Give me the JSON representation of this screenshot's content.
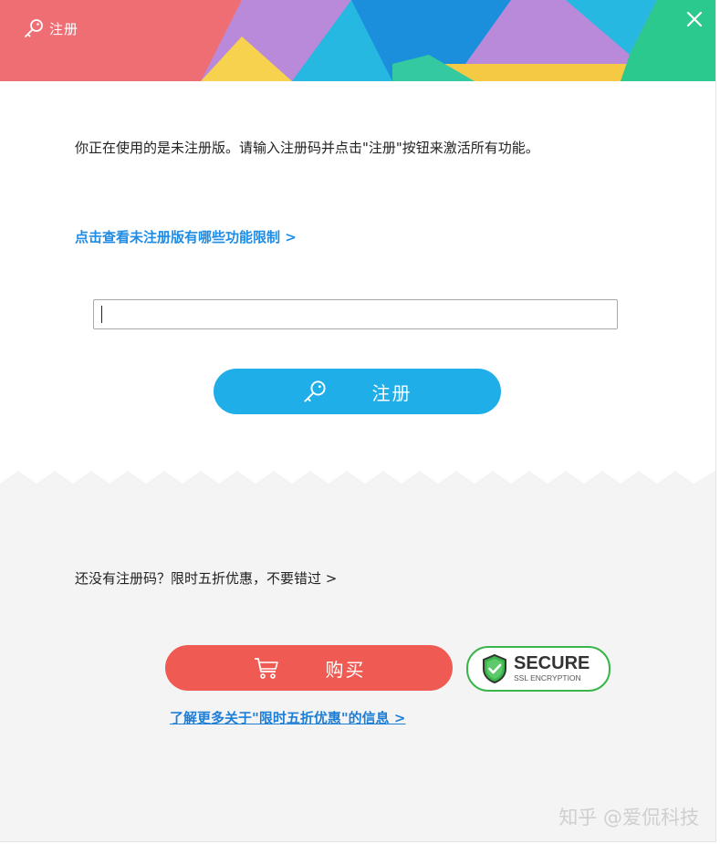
{
  "window": {
    "title": "注册",
    "colors": {
      "accent": "#1faee8",
      "buy": "#ef5b52",
      "link": "#1f8ce6",
      "secure_green": "#39b54a"
    }
  },
  "main": {
    "intro_text": "你正在使用的是未注册版。请输入注册码并点击\"注册\"按钮来激活所有功能。",
    "limits_link": "点击查看未注册版有哪些功能限制 >",
    "code_input": {
      "value": "",
      "placeholder": ""
    },
    "register_button": "注册"
  },
  "footer": {
    "promo_text": "还没有注册码？限时五折优惠，不要错过 >",
    "buy_button": "购买",
    "secure_badge": {
      "title": "SECURE",
      "subtitle": "SSL ENCRYPTION"
    },
    "more_info_link": "了解更多关于\"限时五折优惠\"的信息 >",
    "watermark": "知乎 @爱侃科技"
  },
  "icons": {
    "title": "key-icon",
    "close": "close-icon",
    "register": "key-icon",
    "buy": "cart-icon",
    "secure": "shield-check-icon"
  }
}
